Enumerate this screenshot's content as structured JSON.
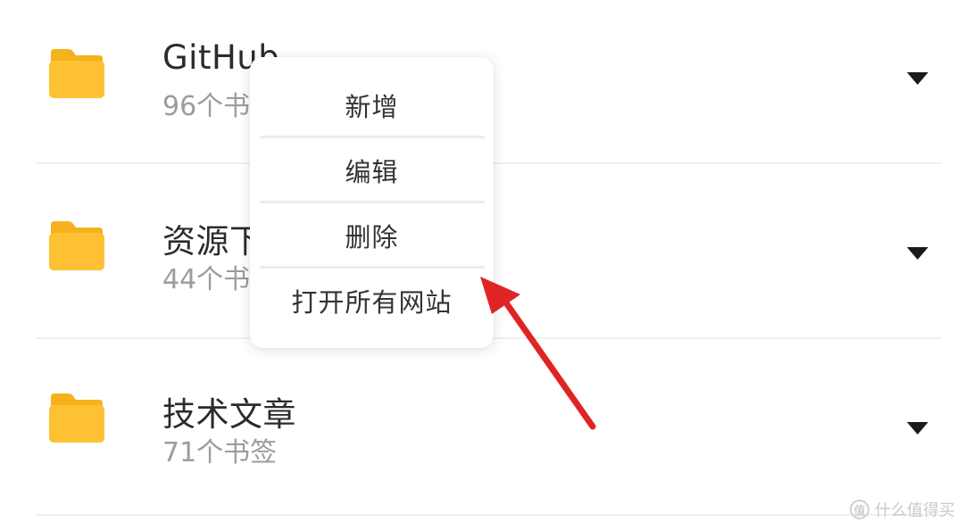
{
  "folders": [
    {
      "title": "GitHub",
      "count": "96个书签",
      "icon": "folder-icon",
      "expand_icon": "caret-down-icon"
    },
    {
      "title": "资源下载",
      "count": "44个书签",
      "icon": "folder-icon",
      "expand_icon": "caret-down-icon"
    },
    {
      "title": "技术文章",
      "count": "71个书签",
      "icon": "folder-icon",
      "expand_icon": "caret-down-icon"
    }
  ],
  "context_menu": {
    "items": [
      "新增",
      "编辑",
      "删除",
      "打开所有网站"
    ]
  },
  "watermark": {
    "logo_text": "值",
    "text": "什么值得买"
  },
  "colors": {
    "folder": "#FDC133",
    "folder_tab": "#F6B21C",
    "arrow_annotation": "#E02424",
    "menu_separator": "#E9ECF7"
  }
}
